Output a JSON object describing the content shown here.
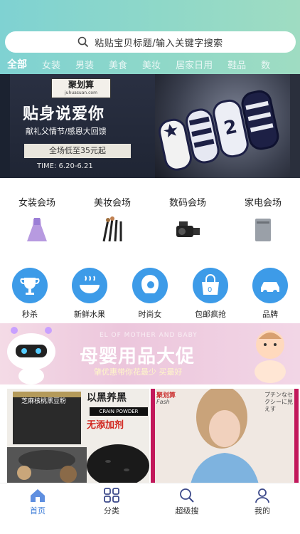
{
  "search": {
    "placeholder": "粘贴宝贝标题/输入关键字搜索"
  },
  "tabs": [
    "全部",
    "女装",
    "男装",
    "美食",
    "美妆",
    "居家日用",
    "鞋品",
    "数"
  ],
  "banner": {
    "brand_cn": "聚划算",
    "brand_url": "juhuasuan.com",
    "headline": "贴身说爱你",
    "subline": "献礼父情节/感恩大回馈",
    "offer": "全场低至35元起",
    "time": "TIME: 6.20-6.21"
  },
  "venues": [
    "女装会场",
    "美妆会场",
    "数码会场",
    "家电会场"
  ],
  "circles": [
    "秒杀",
    "新鲜水果",
    "时尚女",
    "包邮疯抢",
    "品牌"
  ],
  "promo": {
    "en": "EL OF MOTHER AND BABY",
    "title": "母婴用品大促",
    "sub": "肇优惠带你花最少 买最好"
  },
  "products": {
    "left": {
      "title": "以黑养黑",
      "tag": "CRAIN POWDER",
      "highlight": "无添加剂",
      "jar": "芝麻核桃黑豆粉"
    },
    "right": {
      "logo": "聚划算",
      "note": "Fash",
      "jp": "プチンなセクシーに見えす"
    }
  },
  "nav": [
    "首页",
    "分类",
    "超级搜",
    "我的"
  ],
  "colors": {
    "accent": "#3d9be8",
    "nav_active": "#3d7dd8",
    "header": "#8fd8c8"
  }
}
